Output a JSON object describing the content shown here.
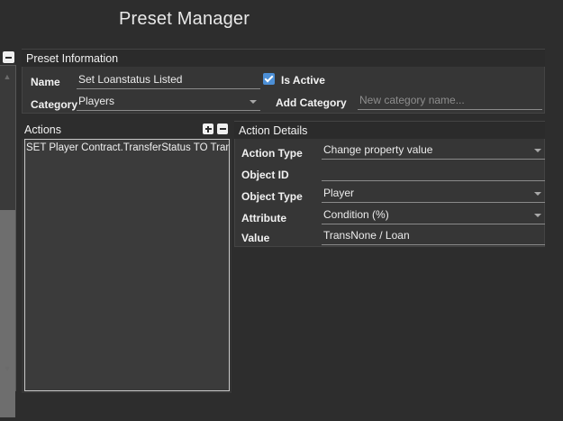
{
  "window": {
    "title": "Preset Manager"
  },
  "preset_info": {
    "header": "Preset Information",
    "name_label": "Name",
    "name_value": "Set Loanstatus Listed",
    "category_label": "Category",
    "category_value": "Players",
    "is_active_label": "Is Active",
    "is_active": true,
    "add_category_label": "Add Category",
    "add_category_placeholder": "New category name..."
  },
  "actions": {
    "header": "Actions",
    "items": [
      {
        "label": "SET Player Contract.TransferStatus TO TransNone / Loan"
      }
    ]
  },
  "action_details": {
    "header": "Action Details",
    "action_type_label": "Action Type",
    "action_type_value": "Change property value",
    "object_id_label": "Object ID",
    "object_id_value": "",
    "object_type_label": "Object Type",
    "object_type_value": "Player",
    "attribute_label": "Attribute",
    "attribute_value": "Condition (%)",
    "value_label": "Value",
    "value_value": "TransNone / Loan"
  },
  "icons": {
    "collapse": "minus-icon",
    "add_action": "plus-icon",
    "remove_action": "minus-icon",
    "dropdown": "chevron-down-icon",
    "checkbox": "checkmark-icon"
  },
  "colors": {
    "background": "#2d2d2d",
    "panel": "#363636",
    "accent": "#4c8fd6",
    "text": "#f2f2f2"
  }
}
